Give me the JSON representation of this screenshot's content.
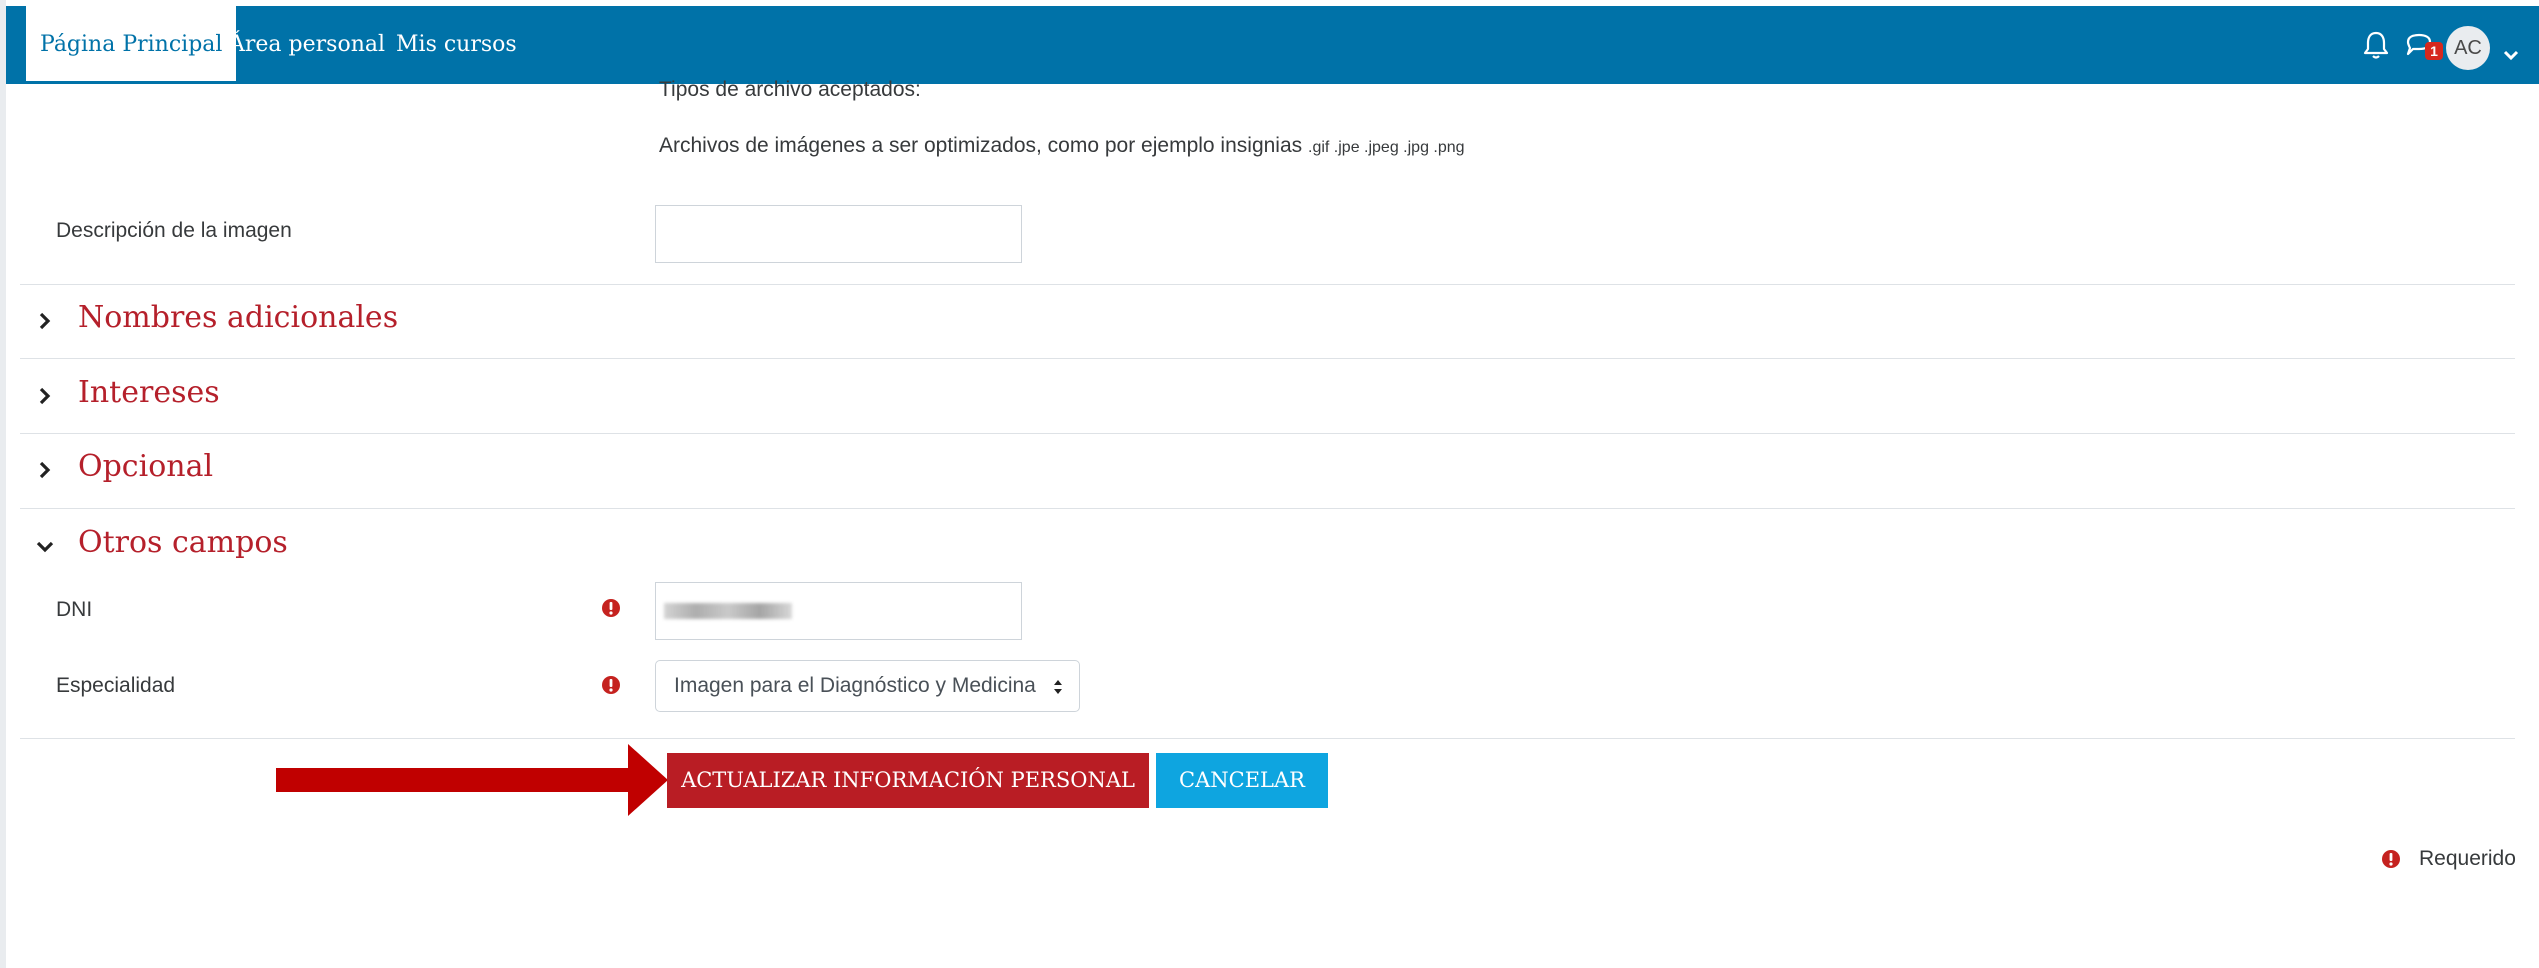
{
  "navbar": {
    "home_label": "Página Principal",
    "personal_area_label": "Área personal",
    "my_courses_label": "Mis cursos",
    "notifications_badge": "1",
    "avatar_initials": "AC"
  },
  "image_section": {
    "accepted_types_label": "Tipos de archivo aceptados:",
    "file_types_description": "Archivos de imágenes a ser optimizados, como por ejemplo insignias",
    "file_extensions": ".gif .jpe .jpeg .jpg .png",
    "image_description_label": "Descripción de la imagen",
    "image_description_value": ""
  },
  "sections": {
    "additional_names": "Nombres adicionales",
    "interests": "Intereses",
    "optional": "Opcional",
    "other_fields": "Otros campos"
  },
  "other_fields": {
    "dni_label": "DNI",
    "specialty_label": "Especialidad",
    "specialty_value": "Imagen para el Diagnóstico y Medicina"
  },
  "buttons": {
    "update_label": "ACTUALIZAR INFORMACIÓN PERSONAL",
    "cancel_label": "CANCELAR"
  },
  "footer": {
    "required_label": "Requerido"
  },
  "colors": {
    "navbar": "#0072a8",
    "section_title": "#b5202b",
    "primary_button": "#b91d24",
    "cancel_button": "#0ea5e0",
    "annotation_arrow": "#c00000"
  }
}
